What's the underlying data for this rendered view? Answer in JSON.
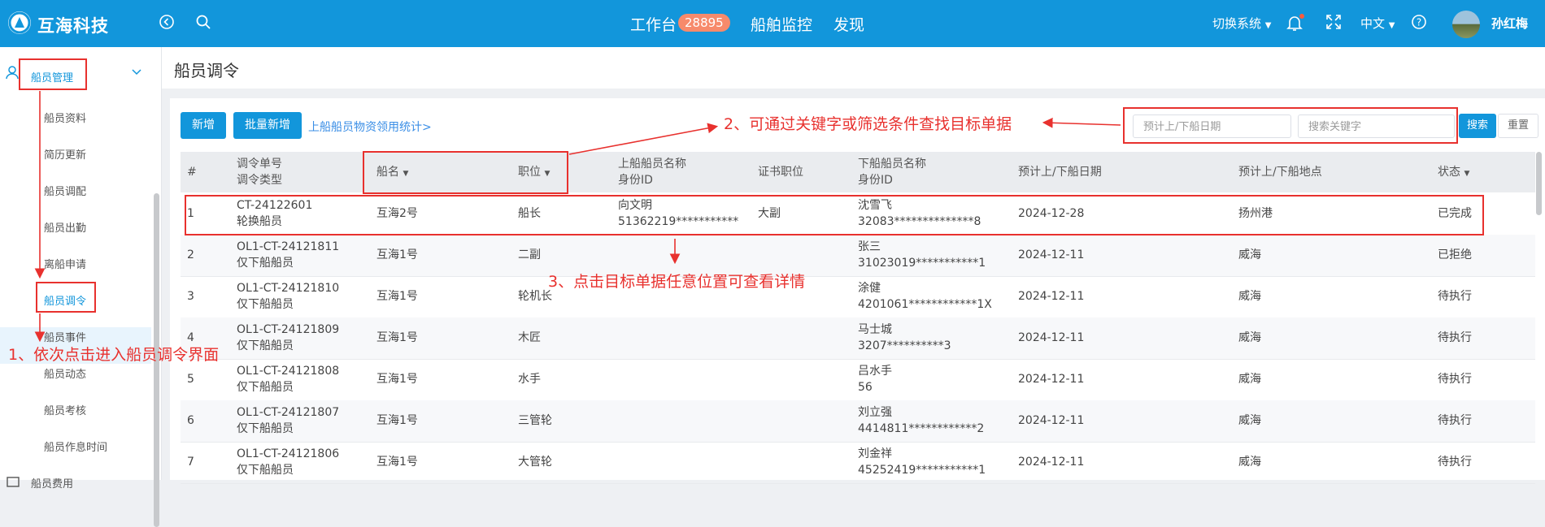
{
  "header": {
    "app_name": "互海科技",
    "nav": {
      "workbench": "工作台",
      "workbench_badge": "28895",
      "ship_monitor": "船舶监控",
      "discover": "发现"
    },
    "switch_system": "切换系统",
    "language": "中文",
    "username": "孙红梅"
  },
  "sidebar": {
    "group_label": "船员管理",
    "items": [
      "船员资料",
      "简历更新",
      "船员调配",
      "船员出勤",
      "离船申请",
      "船员调令",
      "船员事件",
      "船员动态",
      "船员考核",
      "船员作息时间"
    ],
    "next_group_label": "船员费用"
  },
  "page": {
    "title": "船员调令"
  },
  "toolbar": {
    "add_label": "新增",
    "batch_add_label": "批量新增",
    "stats_link": "上船船员物资领用统计>",
    "date_placeholder": "预计上/下船日期",
    "keyword_placeholder": "搜索关键字",
    "search_label": "搜索",
    "reset_label": "重置"
  },
  "table": {
    "headers": {
      "index": "#",
      "order_no": "调令单号",
      "order_type": "调令类型",
      "ship": "船名",
      "position": "职位",
      "board_name": "上船船员名称",
      "board_id": "身份ID",
      "cert_position": "证书职位",
      "leave_name": "下船船员名称",
      "leave_id": "身份ID",
      "date": "预计上/下船日期",
      "place": "预计上/下船地点",
      "status": "状态"
    },
    "rows": [
      {
        "idx": "1",
        "no": "CT-24122601",
        "type": "轮换船员",
        "ship": "互海2号",
        "pos": "船长",
        "bname": "向文明",
        "bid": "51362219***********",
        "cert": "大副",
        "lname": "沈雪飞",
        "lid": "32083**************8",
        "date": "2024-12-28",
        "place": "扬州港",
        "status": "已完成"
      },
      {
        "idx": "2",
        "no": "OL1-CT-24121811",
        "type": "仅下船船员",
        "ship": "互海1号",
        "pos": "二副",
        "bname": "",
        "bid": "",
        "cert": "",
        "lname": "张三",
        "lid": "31023019***********1",
        "date": "2024-12-11",
        "place": "威海",
        "status": "已拒绝"
      },
      {
        "idx": "3",
        "no": "OL1-CT-24121810",
        "type": "仅下船船员",
        "ship": "互海1号",
        "pos": "轮机长",
        "bname": "",
        "bid": "",
        "cert": "",
        "lname": "涂健",
        "lid": "4201061************1X",
        "date": "2024-12-11",
        "place": "威海",
        "status": "待执行"
      },
      {
        "idx": "4",
        "no": "OL1-CT-24121809",
        "type": "仅下船船员",
        "ship": "互海1号",
        "pos": "木匠",
        "bname": "",
        "bid": "",
        "cert": "",
        "lname": "马士城",
        "lid": "3207**********3",
        "date": "2024-12-11",
        "place": "威海",
        "status": "待执行"
      },
      {
        "idx": "5",
        "no": "OL1-CT-24121808",
        "type": "仅下船船员",
        "ship": "互海1号",
        "pos": "水手",
        "bname": "",
        "bid": "",
        "cert": "",
        "lname": "吕水手",
        "lid": "56",
        "date": "2024-12-11",
        "place": "威海",
        "status": "待执行"
      },
      {
        "idx": "6",
        "no": "OL1-CT-24121807",
        "type": "仅下船船员",
        "ship": "互海1号",
        "pos": "三管轮",
        "bname": "",
        "bid": "",
        "cert": "",
        "lname": "刘立强",
        "lid": "4414811************2",
        "date": "2024-12-11",
        "place": "威海",
        "status": "待执行"
      },
      {
        "idx": "7",
        "no": "OL1-CT-24121806",
        "type": "仅下船船员",
        "ship": "互海1号",
        "pos": "大管轮",
        "bname": "",
        "bid": "",
        "cert": "",
        "lname": "刘金祥",
        "lid": "45252419***********1",
        "date": "2024-12-11",
        "place": "威海",
        "status": "待执行"
      }
    ]
  },
  "annotations": {
    "step1": "1、依次点击进入船员调令界面",
    "step2": "2、可通过关键字或筛选条件查找目标单据",
    "step3": "3、点击目标单据任意位置可查看详情"
  },
  "colors": {
    "header": "#1296db",
    "annotation": "#e8312e",
    "badge": "#f78a6b"
  }
}
